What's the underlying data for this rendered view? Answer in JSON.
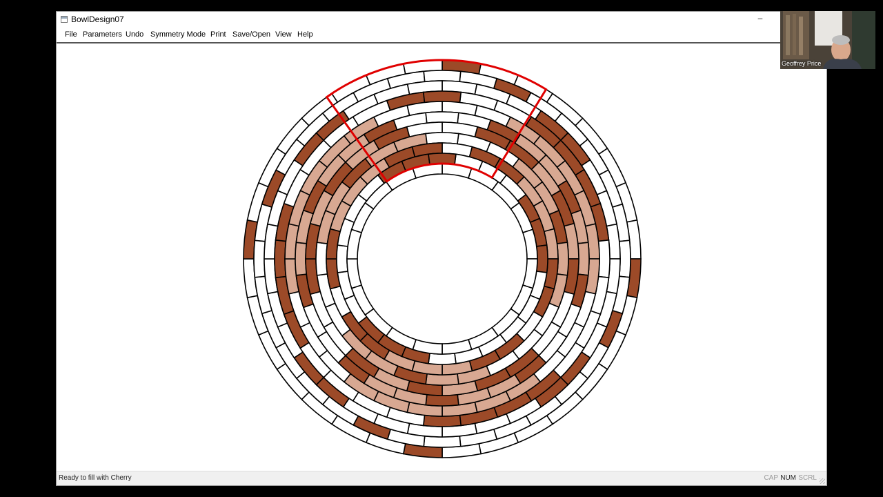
{
  "window": {
    "title": "BowlDesign07",
    "minimize_glyph": "–"
  },
  "menu": {
    "items": [
      "File",
      "Parameters",
      "Undo",
      "Symmetry Mode",
      "Print",
      "Save/Open",
      "View",
      "Help"
    ]
  },
  "status": {
    "text": "Ready to fill with Cherry",
    "indicators": [
      {
        "label": "CAP",
        "active": false
      },
      {
        "label": "NUM",
        "active": true
      },
      {
        "label": "SCRL",
        "active": false
      }
    ]
  },
  "webcam": {
    "name": "Geoffrey Price"
  },
  "design": {
    "rings": [
      {
        "segments": 32,
        "colors": "BWWWWWWWBWWWWWWWBWWWWWWWBWWWWWWW"
      },
      {
        "segments": 32,
        "colors": "WBWWWWWWWBWWWWWWWBWWWWWWWBWWWWWW"
      },
      {
        "segments": 32,
        "colors": "WWWBBWWWWWWBBWWWWWWBBWWWWWWBBWWW"
      },
      {
        "segments": 28,
        "colors": "WWBBBBWWWWBBBBWWWWBBBBWWWWBB"
      },
      {
        "segments": 28,
        "colors": "WWLLLLLLWWWLLLLLLWWWLLLLLLWW"
      },
      {
        "segments": 28,
        "colors": "WBLLBLLBWWBLLBLLBWWBLLBLLBWW"
      },
      {
        "segments": 24,
        "colors": "WBBLBLBWWBBLBLBWWBBLBLBW"
      },
      {
        "segments": 24,
        "colors": "WWLLBLLWWWLLBLLWWWLLBLLW"
      },
      {
        "segments": 24,
        "colors": "WBBLLLBBWBBLLLBBWBBLLLBB"
      },
      {
        "segments": 24,
        "colors": "WWWBBBWWWWWWBBBWWWWWWBBB"
      },
      {
        "segments": 20,
        "colors": "WWWWWWWWWWWWWWWWWWWW"
      }
    ],
    "palette": {
      "W": "#ffffff",
      "B": "#9c4a28",
      "L": "#d8a892"
    },
    "highlight_color": "#e00000"
  }
}
